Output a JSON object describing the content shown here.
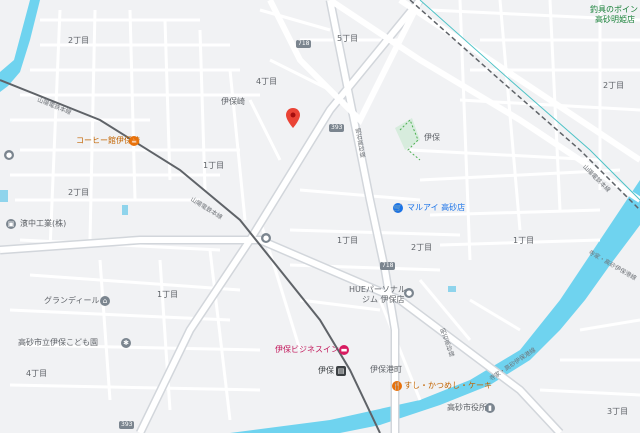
{
  "map": {
    "colors": {
      "background": "#f1f2f4",
      "road": "#ffffff",
      "major_road": "#c8ccd2",
      "railway": "#5f6368",
      "river": "#6fd3ef",
      "park": "#cfe8d6",
      "pin": "#ea4335",
      "orange": "#e8710a",
      "blue": "#1a73e8",
      "pink": "#d81b60"
    },
    "areas": {
      "a_2chome_top": "2丁目",
      "a_5chome_top": "5丁目",
      "a_4chome": "4丁目",
      "a_ihozaki": "伊保崎",
      "a_1chome_left": "1丁目",
      "a_2chome_left": "2丁目",
      "a_iho": "伊保",
      "a_2chome_right": "2丁目",
      "a_1chome_mid": "1丁目",
      "a_2chome_mid": "2丁目",
      "a_1chome_right": "1丁目",
      "a_1chome_bottomleft": "1丁目",
      "a_4chome_bottom": "4丁目",
      "a_ihominato": "伊保港町",
      "a_3chome_br": "3丁目"
    },
    "pois": {
      "coffee": "コーヒー館伊保崎",
      "marui": "マルアイ 高砂店",
      "hasanaka": "濱中工業(株)",
      "grandir": "グランディール",
      "kodomoen": "高砂市立伊保こども園",
      "hue_gym_line1": "HUEパーソナル",
      "hue_gym_line2": "ジム 伊保店",
      "business_inn": "伊保ビジネスイン",
      "sushi": "すし・かつめし・ケーキ",
      "city_office": "高砂市役所",
      "top_right_line1": "釣具のポイント",
      "top_right_line2": "高砂明姫店"
    },
    "station": "伊保",
    "routes": {
      "r718_top": "718",
      "r393_mid": "393",
      "r718_mid": "718",
      "r393_bottom": "393"
    },
    "road_names": {
      "sanyo_main_1": "山陽電鉄本線",
      "sanyo_main_2": "山陽電鉄本線",
      "meiseki_1": "明石高砂線",
      "meiseki_2": "明石高砂線",
      "sanyo_right": "山陽電鉄本線",
      "prefroad_1": "寺家・高砂伊保港線",
      "prefroad_2": "寺家・高砂伊保港線"
    }
  }
}
